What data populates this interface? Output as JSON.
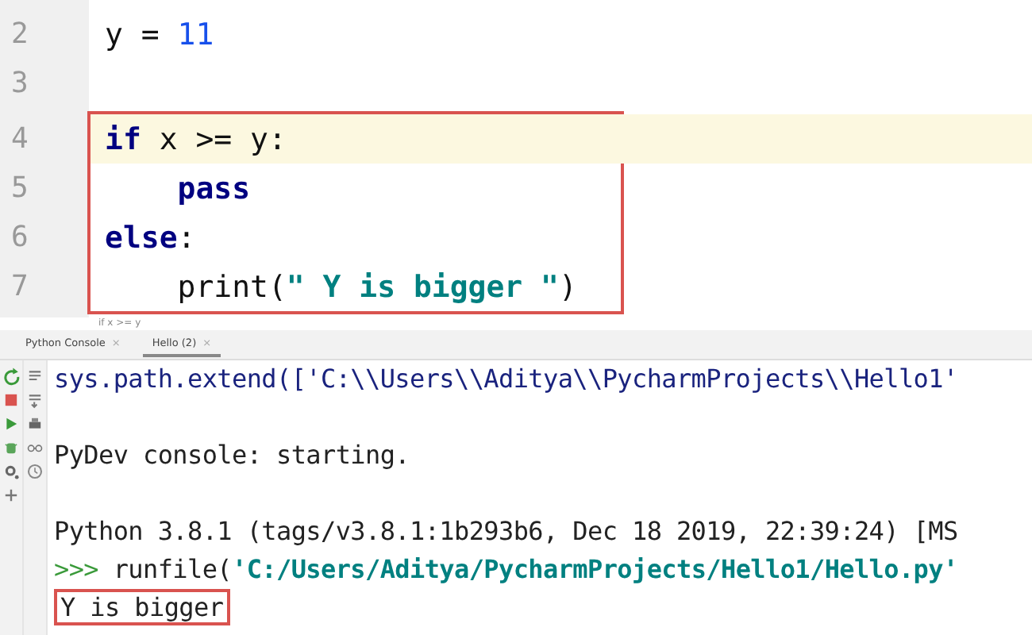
{
  "editor": {
    "blocks": [
      {
        "boxed": false,
        "lines": [
          {
            "number": "2",
            "current": false,
            "indent": false,
            "tokens": [
              {
                "kind": "plain",
                "text": "y = "
              },
              {
                "kind": "number",
                "text": "11"
              }
            ]
          },
          {
            "number": "3",
            "current": false
          }
        ]
      },
      {
        "boxed": true,
        "lines": [
          {
            "number": "4",
            "current": true,
            "indent": false,
            "tokens": [
              {
                "kind": "keyword",
                "text": "if"
              },
              {
                "kind": "plain",
                "text": " x >= y:"
              }
            ]
          },
          {
            "number": "5",
            "current": false,
            "indent": true,
            "tokens": [
              {
                "kind": "keyword",
                "text": "pass"
              }
            ]
          },
          {
            "number": "6",
            "current": false,
            "indent": false,
            "tokens": [
              {
                "kind": "keyword",
                "text": "else"
              },
              {
                "kind": "plain",
                "text": ":"
              }
            ]
          },
          {
            "number": "7",
            "current": false,
            "indent": true,
            "tokens": [
              {
                "kind": "plain",
                "text": "print("
              },
              {
                "kind": "string",
                "text": "\" Y is bigger \""
              },
              {
                "kind": "plain",
                "text": ")"
              }
            ]
          }
        ]
      }
    ],
    "breadcrumb": "if x >= y"
  },
  "tabs": [
    {
      "label": "Python Console",
      "selected": false,
      "close": "×"
    },
    {
      "label": "Hello (2)",
      "selected": true,
      "close": "×"
    }
  ],
  "console": {
    "lines": [
      {
        "kind": "input",
        "boxed": false,
        "tokens": [
          {
            "kind": "plain",
            "text": "sys.path.extend(['C:\\\\Users\\\\Aditya\\\\PycharmProjects\\\\Hello1'"
          }
        ]
      },
      {
        "kind": "blank"
      },
      {
        "kind": "output",
        "boxed": false,
        "tokens": [
          {
            "kind": "plain",
            "text": "PyDev console: starting."
          }
        ]
      },
      {
        "kind": "blank"
      },
      {
        "kind": "output",
        "boxed": false,
        "tokens": [
          {
            "kind": "plain",
            "text": "Python 3.8.1 (tags/v3.8.1:1b293b6, Dec 18 2019, 22:39:24) [MS"
          }
        ]
      },
      {
        "kind": "output",
        "boxed": false,
        "tokens": [
          {
            "kind": "prompt",
            "text": ">>>"
          },
          {
            "kind": "plain",
            "text": " runfile("
          },
          {
            "kind": "string",
            "text": "'C:/Users/Aditya/PycharmProjects/Hello1/Hello.py'"
          }
        ]
      },
      {
        "kind": "output",
        "boxed": true,
        "tokens": [
          {
            "kind": "plain",
            "text": "Y is bigger"
          }
        ]
      }
    ]
  }
}
